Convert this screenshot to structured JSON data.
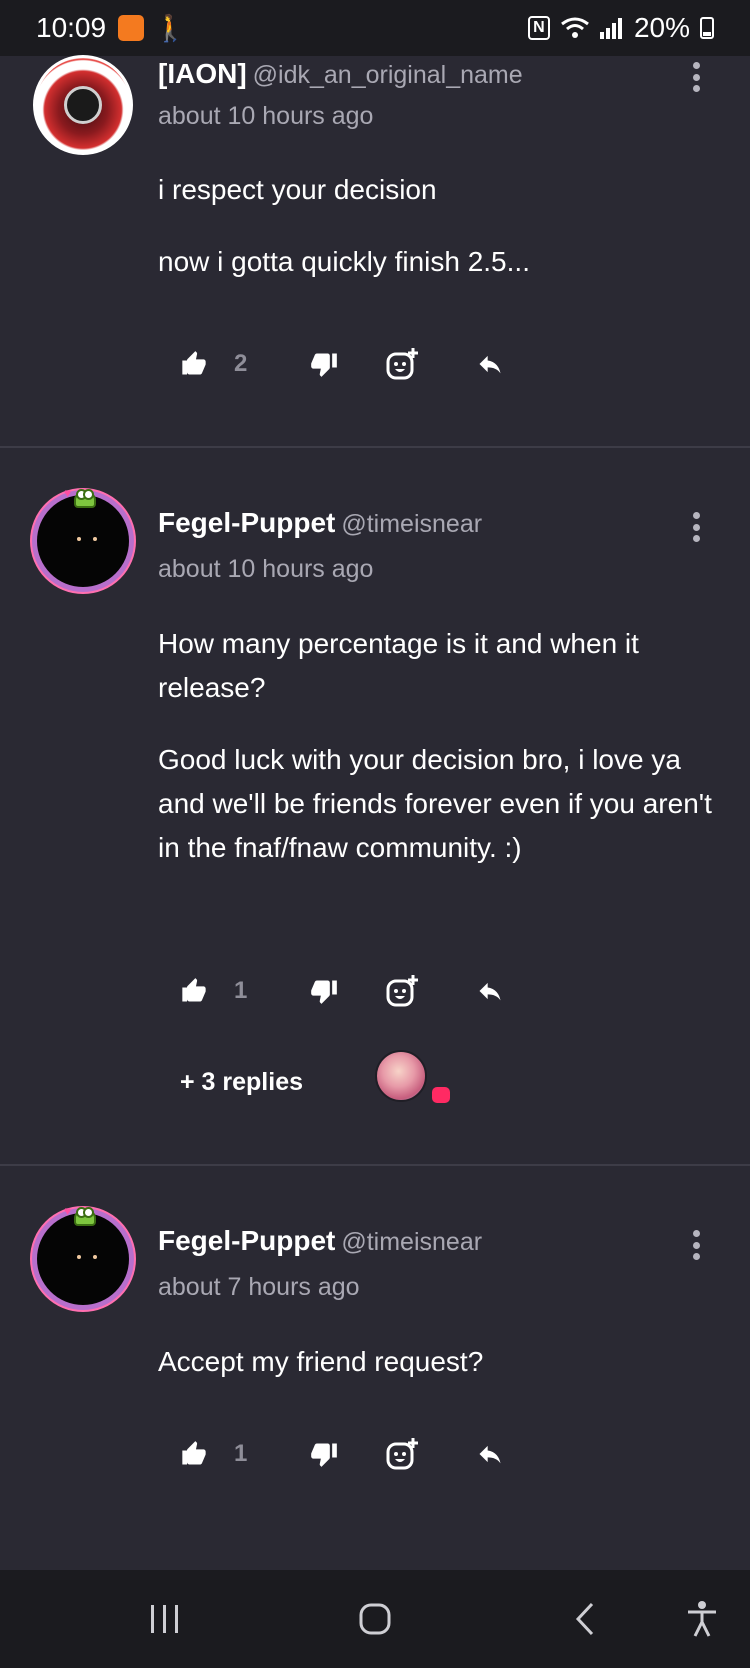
{
  "status_bar": {
    "time": "10:09",
    "battery": "20%",
    "app_icon_color": "#f47a1f"
  },
  "comments": [
    {
      "name": "[IAON]",
      "handle": "@idk_an_original_name",
      "time": "about 10 hours ago",
      "paragraphs": [
        "i respect your decision",
        "now i gotta quickly finish 2.5..."
      ],
      "likes": "2"
    },
    {
      "name": "Fegel-Puppet",
      "handle": "@timeisnear",
      "time": "about 10 hours ago",
      "paragraphs": [
        "How many percentage is it and when it release?",
        "Good luck with your decision bro, i love ya and we'll be friends forever even if you aren't in the fnaf/fnaw community. :)"
      ],
      "likes": "1",
      "replies_label": "+ 3 replies"
    },
    {
      "name": "Fegel-Puppet",
      "handle": "@timeisnear",
      "time": "about 7 hours ago",
      "paragraphs": [
        "Accept my friend request?"
      ],
      "likes": "1"
    }
  ],
  "icons": {
    "like": "thumbs-up-icon",
    "dislike": "thumbs-down-icon",
    "react": "add-reaction-icon",
    "reply": "reply-icon",
    "more": "more-vert-icon"
  },
  "colors": {
    "background": "#2a2933",
    "muted_text": "#a9a8b3",
    "divider": "#3d3c47",
    "reply_badge": "#ff2a63"
  }
}
